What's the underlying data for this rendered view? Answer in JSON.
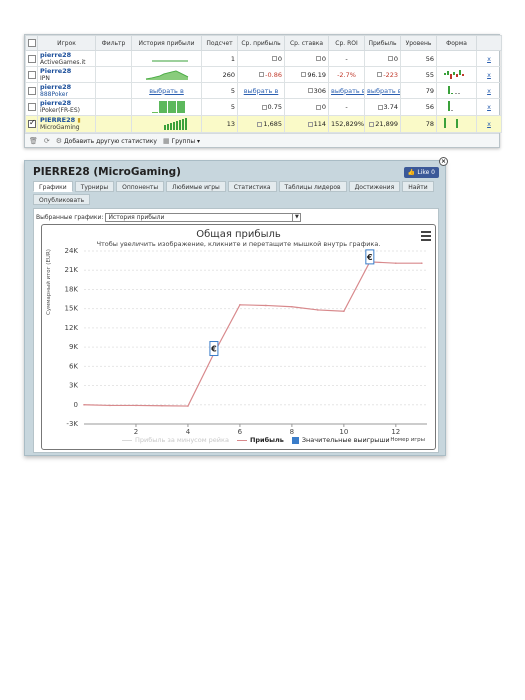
{
  "table": {
    "headers": [
      "Игрок",
      "Фильтр",
      "История прибыли",
      "Подсчет",
      "Ср. прибыль",
      "Ср. ставка",
      "Ср. ROI",
      "Прибыль",
      "Уровень",
      "Форма"
    ],
    "rows": [
      {
        "name": "pierre28",
        "site": "ActiveGames.it",
        "history": "",
        "count": "1",
        "avg_profit": "0",
        "avg_stake": "0",
        "roi": "-",
        "profit": "0",
        "level": "56",
        "x": "x"
      },
      {
        "name": "Pierre28",
        "site": "IPN",
        "history": "",
        "count": "260",
        "avg_profit": "-0.86",
        "avg_stake": "96.19",
        "roi": "-2.7%",
        "profit": "-223",
        "level": "55",
        "x": "x"
      },
      {
        "name": "pierre28",
        "site": "888Poker",
        "history": "выбрать в",
        "count": "5",
        "avg_profit": "выбрать в",
        "avg_stake": "306",
        "roi": "выбрать в",
        "profit": "выбрать в",
        "level": "79",
        "x": "x"
      },
      {
        "name": "pierre28",
        "site": "iPoker(FR-ES)",
        "history": "",
        "count": "5",
        "avg_profit": "0.75",
        "avg_stake": "0",
        "roi": "-",
        "profit": "3.74",
        "level": "56",
        "x": "x"
      },
      {
        "name": "PIERRE28",
        "site": "MicroGaming",
        "history": "",
        "count": "13",
        "avg_profit": "1,685",
        "avg_stake": "114",
        "roi": "152,829%",
        "profit": "21,899",
        "level": "78",
        "x": "x"
      }
    ],
    "toolbar_add": "Добавить другую статистику",
    "toolbar_groups": "Группы"
  },
  "panel": {
    "title": "PIERRE28 (MicroGaming)",
    "like": "Like 0",
    "tabs": [
      "Графики",
      "Турниры",
      "Оппоненты",
      "Любимые игры",
      "Статистика",
      "Таблицы лидеров",
      "Достижения",
      "Найти",
      "Опубликовать"
    ],
    "selected_label": "Выбранные графики:",
    "selected_value": "История прибыли"
  },
  "chart_data": {
    "type": "line",
    "title": "Общая прибыль",
    "subtitle": "Чтобы увеличить изображение, кликните и перетащите мышкой внутрь графика.",
    "ylabel": "Суммарный итог (EUR)",
    "xlabel": "Номер игры",
    "ylim": [
      -3000,
      24000
    ],
    "xlim": [
      0,
      13.2
    ],
    "yticks": [
      "24K",
      "21K",
      "18K",
      "15K",
      "12K",
      "9K",
      "6K",
      "3K",
      "0",
      "-3K"
    ],
    "ytick_values": [
      24000,
      21000,
      18000,
      15000,
      12000,
      9000,
      6000,
      3000,
      0,
      -3000
    ],
    "xticks": [
      2,
      4,
      6,
      8,
      10,
      12
    ],
    "series": [
      {
        "name": "Прибыль за минусом рейка",
        "color": "#d8d8d8",
        "values": []
      },
      {
        "name": "Прибыль",
        "color": "#d8898c",
        "x": [
          0,
          1,
          2,
          3,
          4,
          5,
          6,
          7,
          8,
          9,
          10,
          11,
          12,
          13
        ],
        "y": [
          0,
          -100,
          -100,
          -150,
          -200,
          8000,
          15600,
          15500,
          15300,
          14800,
          14600,
          22300,
          22100,
          22100
        ]
      }
    ],
    "flags": [
      {
        "name": "Значительные выигрыши",
        "x": 5,
        "y": 8000,
        "text": "€"
      },
      {
        "name": "Значительные выигрыши",
        "x": 11,
        "y": 22300,
        "text": "€"
      }
    ],
    "legend": [
      "Прибыль за минусом рейка",
      "Прибыль",
      "Значительные выигрыши"
    ],
    "grid": true,
    "legend_position": "bottom"
  }
}
